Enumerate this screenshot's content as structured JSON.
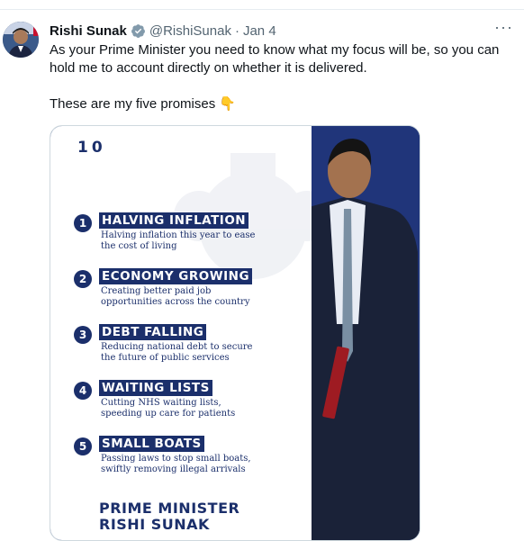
{
  "tweet": {
    "author_name": "Rishi Sunak",
    "handle": "@RishiSunak",
    "separator": "·",
    "date": "Jan 4",
    "more_label": "···",
    "text_line1": "As your Prime Minister you need to know what my focus will be, so you can hold me to account directly on whether it is delivered.",
    "text_line2": "These are my five promises 👇"
  },
  "graphic": {
    "header": "10",
    "promises": [
      {
        "number": "1",
        "title": "HALVING INFLATION",
        "description": "Halving inflation this year to ease the cost of living"
      },
      {
        "number": "2",
        "title": "ECONOMY GROWING",
        "description": "Creating better paid job opportunities across the country"
      },
      {
        "number": "3",
        "title": "DEBT FALLING",
        "description": "Reducing national debt to secure the future of public services"
      },
      {
        "number": "4",
        "title": "WAITING LISTS",
        "description": "Cutting NHS waiting lists, speeding up care for patients"
      },
      {
        "number": "5",
        "title": "SMALL BOATS",
        "description": "Passing laws to stop small boats, swiftly removing illegal arrivals"
      }
    ],
    "footer_line1": "PRIME MINISTER",
    "footer_line2": "RISHI SUNAK"
  },
  "colors": {
    "navy": "#1b2f6b",
    "verified": "#1d9bf0",
    "muted": "#536471"
  },
  "icons": [
    "verified-badge-icon",
    "more-icon",
    "crest-icon"
  ]
}
